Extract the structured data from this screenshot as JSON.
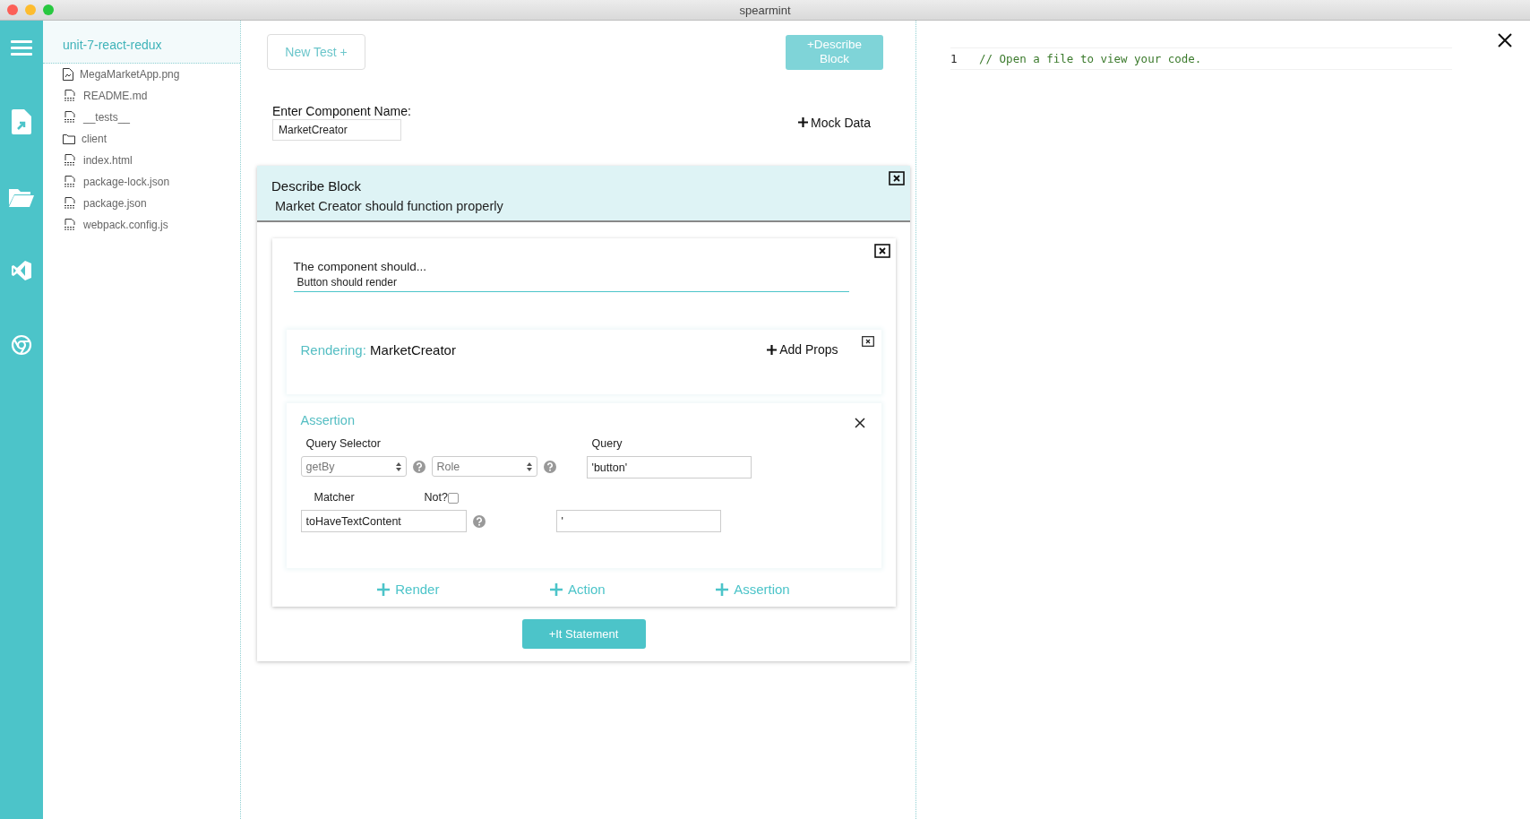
{
  "window": {
    "title": "spearmint"
  },
  "file_tree": {
    "project": "unit-7-react-redux",
    "files": [
      {
        "name": "MegaMarketApp.png",
        "kind": "image"
      },
      {
        "name": "README.md",
        "kind": "text"
      },
      {
        "name": "__tests__",
        "kind": "code"
      },
      {
        "name": "client",
        "kind": "folder"
      },
      {
        "name": "index.html",
        "kind": "html"
      },
      {
        "name": "package-lock.json",
        "kind": "json"
      },
      {
        "name": "package.json",
        "kind": "json"
      },
      {
        "name": "webpack.config.js",
        "kind": "js"
      }
    ]
  },
  "toolbar": {
    "new_test": "New Test +",
    "describe_block": "+Describe Block"
  },
  "component_name": {
    "label": "Enter Component Name:",
    "value": "MarketCreator"
  },
  "mock_data": "Mock Data",
  "describe_block": {
    "title": "Describe Block",
    "description": "Market Creator should function properly",
    "it_block": {
      "prompt": "The component should...",
      "value": "Button should render",
      "rendering": {
        "label": "Rendering:",
        "component": "MarketCreator",
        "add_props": "Add Props"
      },
      "assertion": {
        "title": "Assertion",
        "query_selector_label": "Query Selector",
        "selector": "getBy",
        "query_type": "Role",
        "query_label": "Query",
        "query": "'button'",
        "matcher_label": "Matcher",
        "not_label": "Not?",
        "not_checked": false,
        "matcher": "toHaveTextContent",
        "matcher_value": "'"
      },
      "add_buttons": [
        "Render",
        "Action",
        "Assertion"
      ]
    },
    "it_statement_button": "+It Statement"
  },
  "editor": {
    "lines": [
      {
        "number": "1",
        "text": "// Open a file to view your code."
      }
    ]
  }
}
